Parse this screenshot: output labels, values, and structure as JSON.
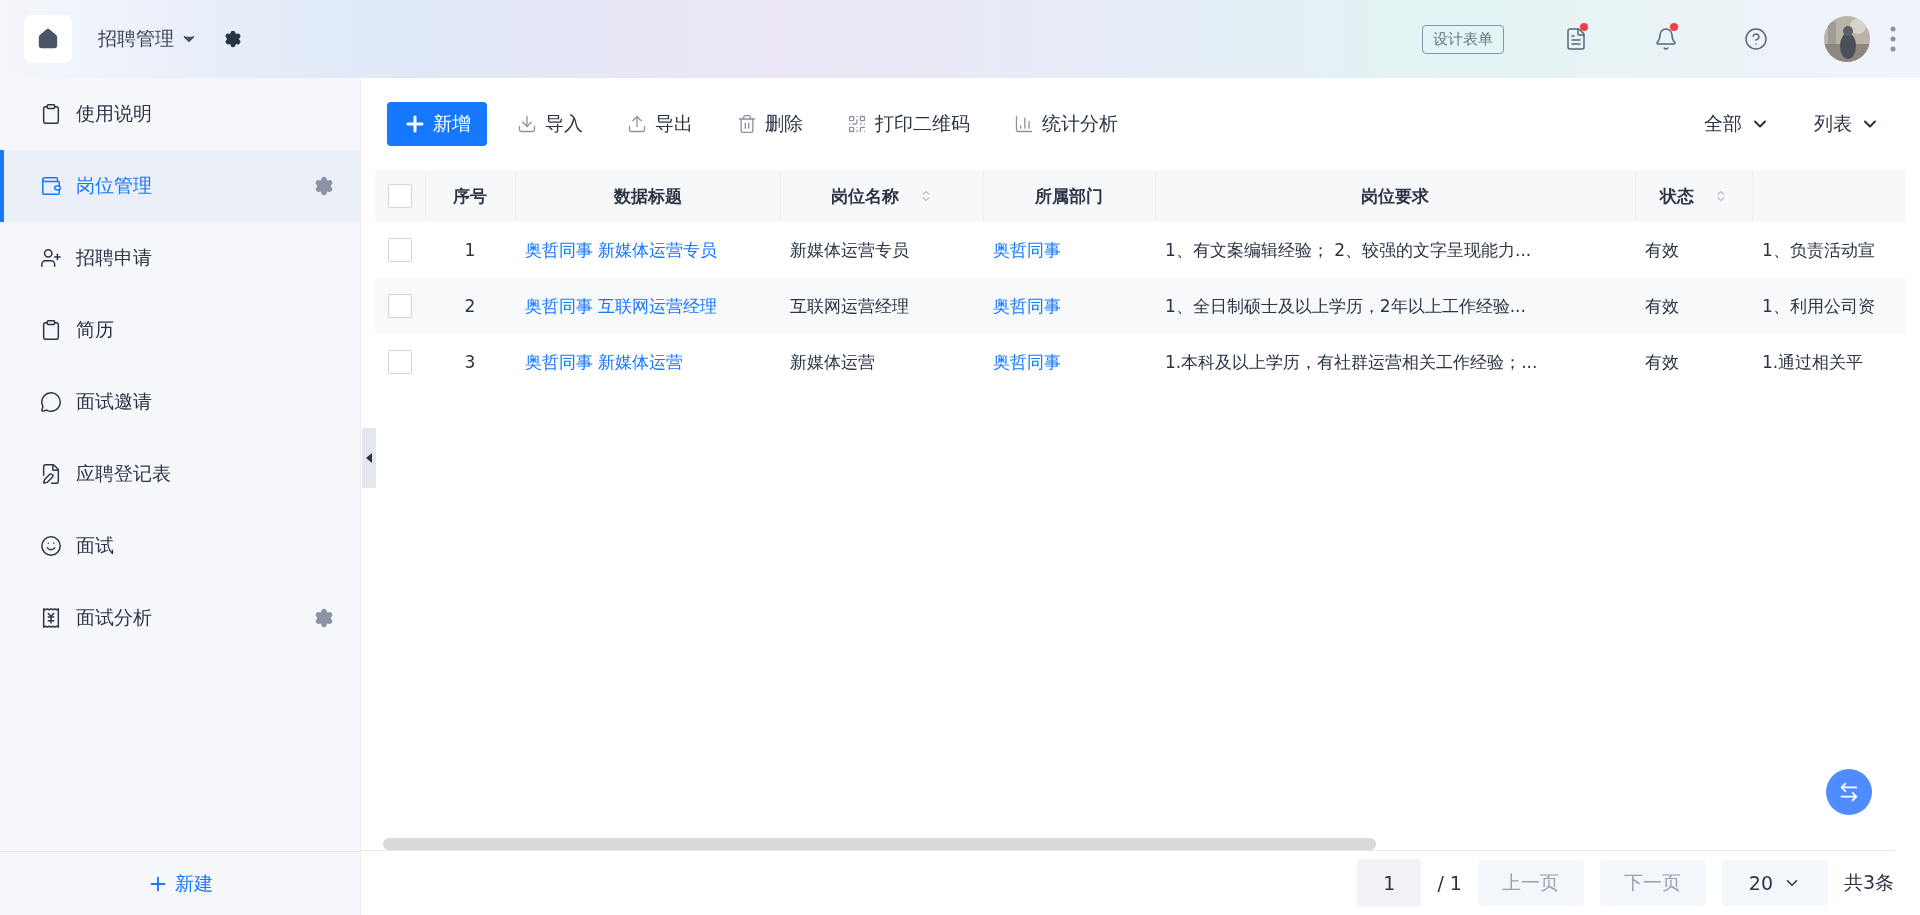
{
  "header": {
    "app_title": "招聘管理",
    "design_button": "设计表单",
    "notifications": [
      {
        "kind": "form",
        "badge": true
      },
      {
        "kind": "bell",
        "badge": true
      },
      {
        "kind": "help",
        "badge": false
      }
    ]
  },
  "sidebar": {
    "items": [
      {
        "label": "使用说明",
        "kind": "clipboard",
        "selected": false,
        "settings": false
      },
      {
        "label": "岗位管理",
        "kind": "wallet",
        "selected": true,
        "settings": true
      },
      {
        "label": "招聘申请",
        "kind": "person",
        "selected": false,
        "settings": false
      },
      {
        "label": "简历",
        "kind": "clipboard",
        "selected": false,
        "settings": false
      },
      {
        "label": "面试邀请",
        "kind": "chat",
        "selected": false,
        "settings": false
      },
      {
        "label": "应聘登记表",
        "kind": "form",
        "selected": false,
        "settings": false
      },
      {
        "label": "面试",
        "kind": "face",
        "selected": false,
        "settings": false
      },
      {
        "label": "面试分析",
        "kind": "report",
        "selected": false,
        "settings": true
      }
    ],
    "new_button": "新建"
  },
  "toolbar": {
    "add": "新增",
    "actions": [
      {
        "kind": "import",
        "label": "导入"
      },
      {
        "kind": "export",
        "label": "导出"
      },
      {
        "kind": "delete",
        "label": "删除"
      },
      {
        "kind": "qr",
        "label": "打印二维码"
      },
      {
        "kind": "stats",
        "label": "统计分析"
      }
    ],
    "filters": [
      "全部",
      "列表"
    ]
  },
  "table": {
    "all_checked": false,
    "columns": [
      {
        "label": "序号",
        "sortable": false
      },
      {
        "label": "数据标题",
        "sortable": false
      },
      {
        "label": "岗位名称",
        "sortable": true
      },
      {
        "label": "所属部门",
        "sortable": false
      },
      {
        "label": "岗位要求",
        "sortable": false
      },
      {
        "label": "状态",
        "sortable": true
      }
    ],
    "rows": [
      {
        "checked": false,
        "cells": [
          "1",
          "奥哲同事 新媒体运营专员",
          "新媒体运营专员",
          "奥哲同事",
          "1、有文案编辑经验； 2、较强的文字呈现能力...",
          "有效",
          "1、负责活动宣"
        ]
      },
      {
        "checked": false,
        "cells": [
          "2",
          "奥哲同事 互联网运营经理",
          "互联网运营经理",
          "奥哲同事",
          "1、全日制硕士及以上学历，2年以上工作经验...",
          "有效",
          "1、利用公司资"
        ]
      },
      {
        "checked": false,
        "cells": [
          "3",
          "奥哲同事 新媒体运营",
          "新媒体运营",
          "奥哲同事",
          "1.本科及以上学历，有社群运营相关工作经验；...",
          "有效",
          "1.通过相关平"
        ]
      }
    ]
  },
  "pagination": {
    "page": "1",
    "total_pages": "/ 1",
    "prev": "上一页",
    "next": "下一页",
    "page_size": "20",
    "total": "共3条"
  }
}
